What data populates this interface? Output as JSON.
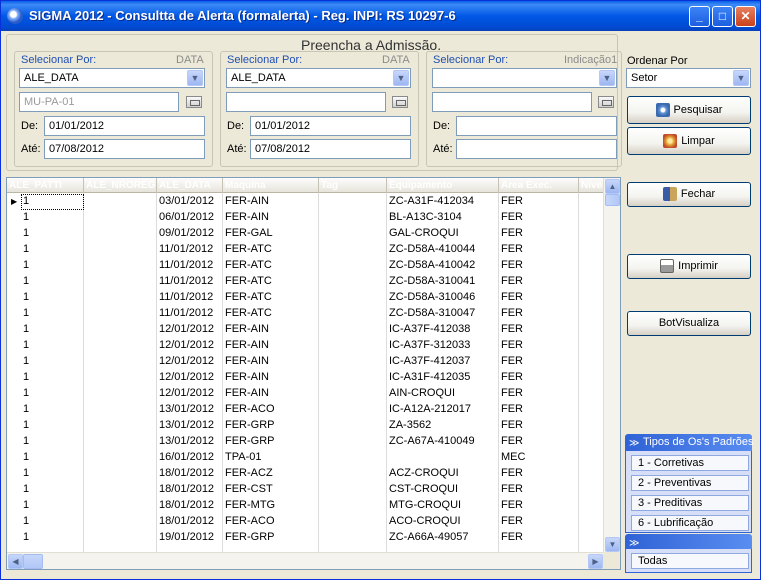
{
  "window": {
    "title": "SIGMA 2012 - Consultta de Alerta  (formalerta)  - Reg. INPI: RS 10297-6",
    "minimize": "_",
    "maximize": "□",
    "close": "✕"
  },
  "form": {
    "heading": "Preencha a Admissão.",
    "group1": {
      "label": "Selecionar Por:",
      "tag": "DATA",
      "select_value": "ALE_DATA",
      "text_value": "MU-PA-01",
      "de_label": "De:",
      "de_value": "01/01/2012",
      "ate_label": "Até:",
      "ate_value": "07/08/2012"
    },
    "group2": {
      "label": "Selecionar Por:",
      "tag": "DATA",
      "select_value": "ALE_DATA",
      "text_value": "",
      "de_label": "De:",
      "de_value": "01/01/2012",
      "ate_label": "Até:",
      "ate_value": "07/08/2012"
    },
    "group3": {
      "label": "Selecionar Por:",
      "tag": "Indicação1",
      "select_value": "",
      "text_value": "",
      "de_label": "De:",
      "de_value": "",
      "ate_label": "Até:",
      "ate_value": ""
    },
    "order": {
      "label": "Ordenar Por",
      "value": "Setor"
    }
  },
  "buttons": {
    "pesquisar": "Pesquisar",
    "limpar": "Limpar",
    "fechar": "Fechar",
    "imprimir": "Imprimir",
    "botvisualiza": "BotVisualiza"
  },
  "grid": {
    "columns": [
      "ALE_PATTI",
      "ALE_NROREG",
      "ALE_DATA",
      "Maquina",
      "Tag",
      "Equipamento",
      "Area Exec.",
      "Nivel"
    ],
    "rows": [
      [
        "1",
        "",
        "03/01/2012",
        "FER-AIN",
        "",
        "ZC-A31F-412034",
        "FER",
        ""
      ],
      [
        "1",
        "",
        "06/01/2012",
        "FER-AIN",
        "",
        "BL-A13C-3104",
        "FER",
        ""
      ],
      [
        "1",
        "",
        "09/01/2012",
        "FER-GAL",
        "",
        "GAL-CROQUI",
        "FER",
        ""
      ],
      [
        "1",
        "",
        "11/01/2012",
        "FER-ATC",
        "",
        "ZC-D58A-410044",
        "FER",
        ""
      ],
      [
        "1",
        "",
        "11/01/2012",
        "FER-ATC",
        "",
        "ZC-D58A-410042",
        "FER",
        ""
      ],
      [
        "1",
        "",
        "11/01/2012",
        "FER-ATC",
        "",
        "ZC-D58A-310041",
        "FER",
        ""
      ],
      [
        "1",
        "",
        "11/01/2012",
        "FER-ATC",
        "",
        "ZC-D58A-310046",
        "FER",
        ""
      ],
      [
        "1",
        "",
        "11/01/2012",
        "FER-ATC",
        "",
        "ZC-D58A-310047",
        "FER",
        ""
      ],
      [
        "1",
        "",
        "12/01/2012",
        "FER-AIN",
        "",
        "IC-A37F-412038",
        "FER",
        ""
      ],
      [
        "1",
        "",
        "12/01/2012",
        "FER-AIN",
        "",
        "IC-A37F-312033",
        "FER",
        ""
      ],
      [
        "1",
        "",
        "12/01/2012",
        "FER-AIN",
        "",
        "IC-A37F-412037",
        "FER",
        ""
      ],
      [
        "1",
        "",
        "12/01/2012",
        "FER-AIN",
        "",
        "IC-A31F-412035",
        "FER",
        ""
      ],
      [
        "1",
        "",
        "12/01/2012",
        "FER-AIN",
        "",
        "AIN-CROQUI",
        "FER",
        ""
      ],
      [
        "1",
        "",
        "13/01/2012",
        "FER-ACO",
        "",
        "IC-A12A-212017",
        "FER",
        ""
      ],
      [
        "1",
        "",
        "13/01/2012",
        "FER-GRP",
        "",
        "ZA-3562",
        "FER",
        ""
      ],
      [
        "1",
        "",
        "13/01/2012",
        "FER-GRP",
        "",
        "ZC-A67A-410049",
        "FER",
        ""
      ],
      [
        "1",
        "",
        "16/01/2012",
        "TPA-01",
        "",
        "",
        "MEC",
        ""
      ],
      [
        "1",
        "",
        "18/01/2012",
        "FER-ACZ",
        "",
        "ACZ-CROQUI",
        "FER",
        ""
      ],
      [
        "1",
        "",
        "18/01/2012",
        "FER-CST",
        "",
        "CST-CROQUI",
        "FER",
        ""
      ],
      [
        "1",
        "",
        "18/01/2012",
        "FER-MTG",
        "",
        "MTG-CROQUI",
        "FER",
        ""
      ],
      [
        "1",
        "",
        "18/01/2012",
        "FER-ACO",
        "",
        "ACO-CROQUI",
        "FER",
        ""
      ],
      [
        "1",
        "",
        "19/01/2012",
        "FER-GRP",
        "",
        "ZC-A66A-49057",
        "FER",
        ""
      ]
    ]
  },
  "tasks": {
    "tipos_title": "Tipos de Os's Padrões",
    "tipos_items": [
      "1 - Corretivas",
      "2 - Preventivas",
      "3 - Preditivas",
      "6 - Lubrificação"
    ],
    "todas_item": "Todas"
  }
}
